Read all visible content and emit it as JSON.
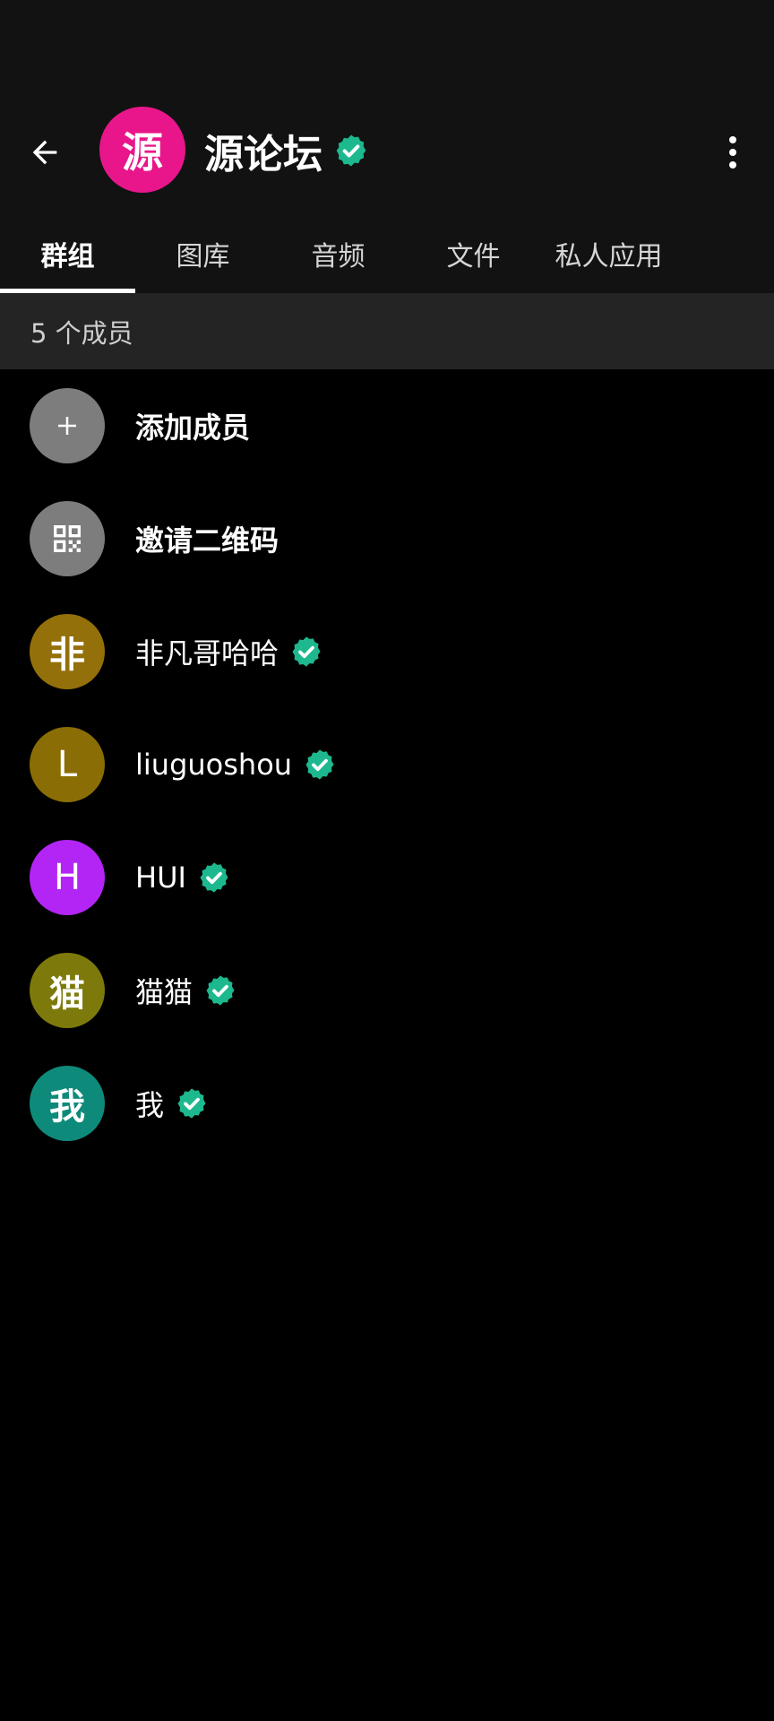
{
  "colors": {
    "background": "#000000",
    "top_bar": "#121212",
    "section_header": "#242424",
    "verified_badge": "#1db88e",
    "group_avatar": "#e8168a"
  },
  "header": {
    "group_avatar_char": "源",
    "title": "源论坛",
    "back_icon": "arrow-left-icon",
    "more_icon": "more-vertical-icon"
  },
  "tabs": [
    {
      "label": "群组",
      "active": true
    },
    {
      "label": "图库",
      "active": false
    },
    {
      "label": "音频",
      "active": false
    },
    {
      "label": "文件",
      "active": false
    },
    {
      "label": "私人应用",
      "active": false
    }
  ],
  "members_header": "5 个成员",
  "actions": [
    {
      "label": "添加成员",
      "icon": "plus-icon",
      "color": "#7d7d7d"
    },
    {
      "label": "邀请二维码",
      "icon": "qr-code-icon",
      "color": "#7d7d7d"
    }
  ],
  "members": [
    {
      "initial": "非",
      "name": "非凡哥哈哈",
      "color": "#94700a",
      "verified": true
    },
    {
      "initial": "L",
      "name": "liuguoshou",
      "color": "#8a6e05",
      "verified": true
    },
    {
      "initial": "H",
      "name": "HUI",
      "color": "#b325f5",
      "verified": true
    },
    {
      "initial": "猫",
      "name": "猫猫",
      "color": "#7d7a0b",
      "verified": true
    },
    {
      "initial": "我",
      "name": "我",
      "color": "#0e8a7a",
      "verified": true
    }
  ]
}
